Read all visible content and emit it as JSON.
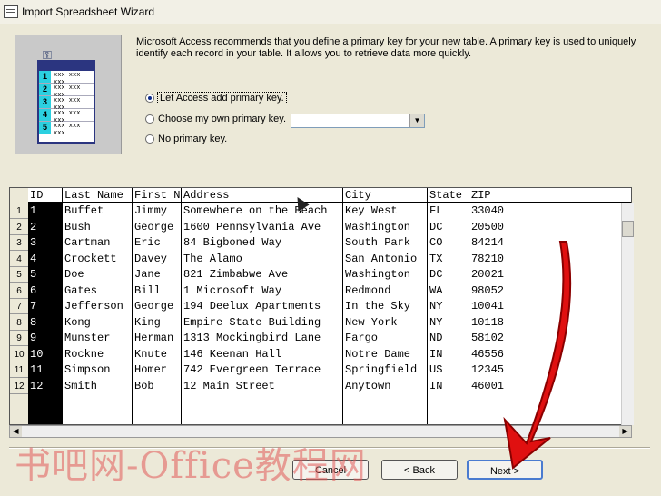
{
  "window": {
    "title": "Import Spreadsheet Wizard"
  },
  "description": "Microsoft Access recommends that you define a primary key for your new table. A primary key is used to uniquely identify each record in your table. It allows you to retrieve data more quickly.",
  "icon_rows": [
    "1",
    "2",
    "3",
    "4",
    "5"
  ],
  "icon_row_text": "xxx xxx xxx",
  "options": [
    {
      "label": "Let Access add primary key.",
      "selected": true
    },
    {
      "label": "Choose my own primary key.",
      "selected": false
    },
    {
      "label": "No primary key.",
      "selected": false
    }
  ],
  "key_field_value": "",
  "table": {
    "columns": [
      "ID",
      "Last Name",
      "First N",
      "Address",
      "City",
      "State",
      "ZIP"
    ],
    "rows": [
      [
        "1",
        "Buffet",
        "Jimmy",
        "Somewhere on the Beach",
        "Key West",
        "FL",
        "33040"
      ],
      [
        "2",
        "Bush",
        "George",
        "1600 Pennsylvania Ave",
        "Washington",
        "DC",
        "20500"
      ],
      [
        "3",
        "Cartman",
        "Eric",
        "84 Bigboned Way",
        "South Park",
        "CO",
        "84214"
      ],
      [
        "4",
        "Crockett",
        "Davey",
        "The Alamo",
        "San Antonio",
        "TX",
        "78210"
      ],
      [
        "5",
        "Doe",
        "Jane",
        "821 Zimbabwe Ave",
        "Washington",
        "DC",
        "20021"
      ],
      [
        "6",
        "Gates",
        "Bill",
        "1 Microsoft Way",
        "Redmond",
        "WA",
        "98052"
      ],
      [
        "7",
        "Jefferson",
        "George",
        "194 Deelux Apartments",
        "In the Sky",
        "NY",
        "10041"
      ],
      [
        "8",
        "Kong",
        "King",
        "Empire State Building",
        "New York",
        "NY",
        "10118"
      ],
      [
        "9",
        "Munster",
        "Herman",
        "1313 Mockingbird Lane",
        "Fargo",
        "ND",
        "58102"
      ],
      [
        "10",
        "Rockne",
        "Knute",
        "146 Keenan Hall",
        "Notre Dame",
        "IN",
        "46556"
      ],
      [
        "11",
        "Simpson",
        "Homer",
        "742 Evergreen Terrace",
        "Springfield",
        "US",
        "12345"
      ],
      [
        "12",
        "Smith",
        "Bob",
        "12 Main Street",
        "Anytown",
        "IN",
        "46001"
      ]
    ],
    "row_numbers": [
      "1",
      "2",
      "3",
      "4",
      "5",
      "6",
      "7",
      "8",
      "9",
      "10",
      "11",
      "12"
    ]
  },
  "buttons": {
    "cancel": "Cancel",
    "back": "< Back",
    "next": "Next >"
  },
  "watermark": "书吧网-Office教程网",
  "colors": {
    "arrow": "#e01010",
    "selection": "#0b2a8a",
    "dialog_bg": "#ece9d8"
  }
}
